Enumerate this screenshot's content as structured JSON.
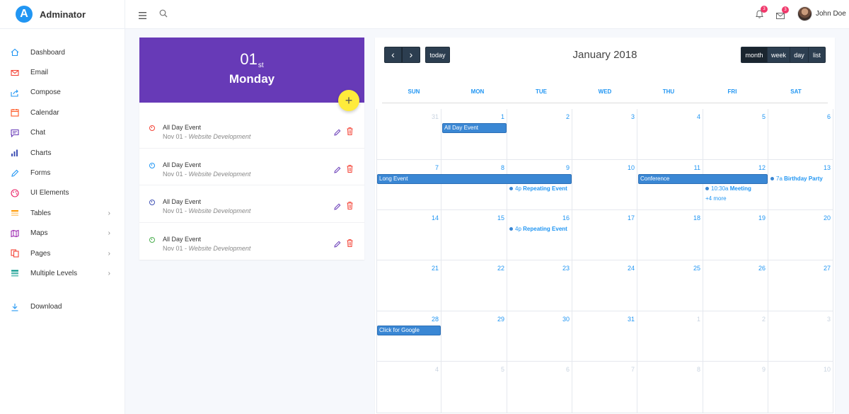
{
  "brand": {
    "logo_letter": "A",
    "name": "Adminator"
  },
  "sidebar": {
    "items": [
      {
        "label": "Dashboard",
        "icon": "home-icon",
        "color": "#2196f3"
      },
      {
        "label": "Email",
        "icon": "mail-icon",
        "color": "#f44336"
      },
      {
        "label": "Compose",
        "icon": "share-icon",
        "color": "#2196f3"
      },
      {
        "label": "Calendar",
        "icon": "calendar-icon",
        "color": "#ff5722"
      },
      {
        "label": "Chat",
        "icon": "chat-icon",
        "color": "#673ab7"
      },
      {
        "label": "Charts",
        "icon": "bar-chart-icon",
        "color": "#3f51b5"
      },
      {
        "label": "Forms",
        "icon": "pencil-icon",
        "color": "#2196f3"
      },
      {
        "label": "UI Elements",
        "icon": "palette-icon",
        "color": "#e91e63"
      },
      {
        "label": "Tables",
        "icon": "table-icon",
        "color": "#ff9800"
      },
      {
        "label": "Maps",
        "icon": "map-icon",
        "color": "#9c27b0"
      },
      {
        "label": "Pages",
        "icon": "files-icon",
        "color": "#f44336"
      },
      {
        "label": "Multiple Levels",
        "icon": "layers-icon",
        "color": "#009688"
      }
    ],
    "download_label": "Download"
  },
  "topbar": {
    "notifications_count": "3",
    "messages_count": "3",
    "user_name": "John Doe"
  },
  "events_panel": {
    "date_number": "01",
    "date_suffix": "st",
    "day_name": "Monday",
    "add_button": "+",
    "events": [
      {
        "title": "All Day Event",
        "date": "Nov 01",
        "sep": " - ",
        "project": "Website Development",
        "color": "#f44336"
      },
      {
        "title": "All Day Event",
        "date": "Nov 01",
        "sep": " - ",
        "project": "Website Development",
        "color": "#2196f3"
      },
      {
        "title": "All Day Event",
        "date": "Nov 01",
        "sep": " - ",
        "project": "Website Development",
        "color": "#3f51b5"
      },
      {
        "title": "All Day Event",
        "date": "Nov 01",
        "sep": " - ",
        "project": "Website Development",
        "color": "#4caf50"
      }
    ]
  },
  "calendar": {
    "title": "January 2018",
    "prev": "‹",
    "next": "›",
    "today_label": "today",
    "views": [
      "month",
      "week",
      "day",
      "list"
    ],
    "active_view": "month",
    "weekdays": [
      "SUN",
      "MON",
      "TUE",
      "WED",
      "THU",
      "FRI",
      "SAT"
    ],
    "weeks": [
      [
        [
          "31",
          true
        ],
        [
          "1",
          false
        ],
        [
          "2",
          false
        ],
        [
          "3",
          false
        ],
        [
          "4",
          false
        ],
        [
          "5",
          false
        ],
        [
          "6",
          false
        ]
      ],
      [
        [
          "7",
          false
        ],
        [
          "8",
          false
        ],
        [
          "9",
          false
        ],
        [
          "10",
          false
        ],
        [
          "11",
          false
        ],
        [
          "12",
          false
        ],
        [
          "13",
          false
        ]
      ],
      [
        [
          "14",
          false
        ],
        [
          "15",
          false
        ],
        [
          "16",
          false
        ],
        [
          "17",
          false
        ],
        [
          "18",
          false
        ],
        [
          "19",
          false
        ],
        [
          "20",
          false
        ]
      ],
      [
        [
          "21",
          false
        ],
        [
          "22",
          false
        ],
        [
          "23",
          false
        ],
        [
          "24",
          false
        ],
        [
          "25",
          false
        ],
        [
          "26",
          false
        ],
        [
          "27",
          false
        ]
      ],
      [
        [
          "28",
          false
        ],
        [
          "29",
          false
        ],
        [
          "30",
          false
        ],
        [
          "31",
          false
        ],
        [
          "1",
          true
        ],
        [
          "2",
          true
        ],
        [
          "3",
          true
        ]
      ],
      [
        [
          "4",
          true
        ],
        [
          "5",
          true
        ],
        [
          "6",
          true
        ],
        [
          "7",
          true
        ],
        [
          "8",
          true
        ],
        [
          "9",
          true
        ],
        [
          "10",
          true
        ]
      ]
    ],
    "bar_events": [
      {
        "label": "All Day Event",
        "week": 0,
        "start": 1,
        "span": 1
      },
      {
        "label": "Long Event",
        "week": 1,
        "start": 0,
        "span": 3
      },
      {
        "label": "Conference",
        "week": 1,
        "start": 4,
        "span": 2
      },
      {
        "label": "Click for Google",
        "week": 4,
        "start": 0,
        "span": 1
      }
    ],
    "dot_events": [
      {
        "time": "4p",
        "title": "Repeating Event",
        "week": 1,
        "day": 2,
        "slot": 1
      },
      {
        "time": "10:30a",
        "title": "Meeting",
        "week": 1,
        "day": 5,
        "slot": 1
      },
      {
        "time": "7a",
        "title": "Birthday Party",
        "week": 1,
        "day": 6,
        "slot": 0
      },
      {
        "time": "4p",
        "title": "Repeating Event",
        "week": 2,
        "day": 2,
        "slot": 0
      }
    ],
    "more_links": [
      {
        "label": "+4 more",
        "week": 1,
        "day": 5
      }
    ]
  }
}
